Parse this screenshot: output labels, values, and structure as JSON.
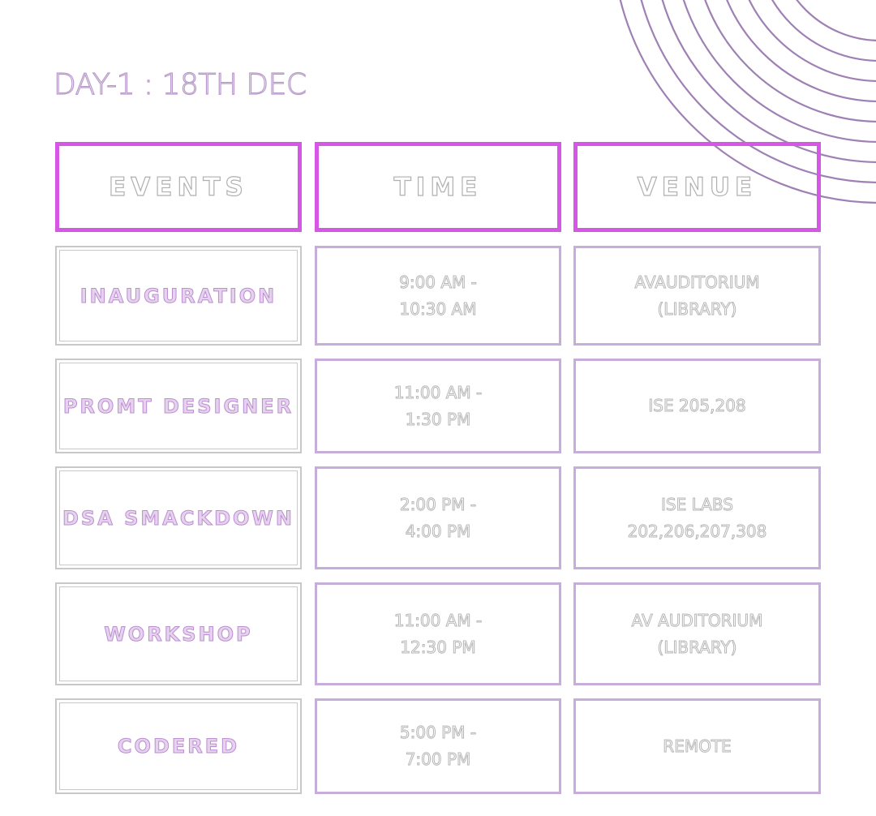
{
  "title": "DAY-1  :  18TH DEC",
  "headers": {
    "events": "EVENTS",
    "time": "TIME",
    "venue": "VENUE"
  },
  "rows": [
    {
      "event": "INAUGURATION",
      "time": "9:00 AM -\n10:30 AM",
      "venue": "AVAUDITORIUM\n(LIBRARY)"
    },
    {
      "event": "PROMT DESIGNER",
      "time": "11:00 AM -\n1:30 PM",
      "venue": "ISE 205,208"
    },
    {
      "event": "DSA SMACKDOWN",
      "time": "2:00 PM -\n4:00 PM",
      "venue": "ISE LABS\n202,206,207,308"
    },
    {
      "event": "WORKSHOP",
      "time": "11:00 AM -\n12:30 PM",
      "venue": "AV AUDITORIUM\n(LIBRARY)"
    },
    {
      "event": "CODERED",
      "time": "5:00 PM -\n7:00 PM",
      "venue": "REMOTE"
    }
  ],
  "colors": {
    "header_border": "#d656e6",
    "cell_border": "#c7addb",
    "arc": "#9a7bb0",
    "event_text": "#bb8ed0"
  }
}
